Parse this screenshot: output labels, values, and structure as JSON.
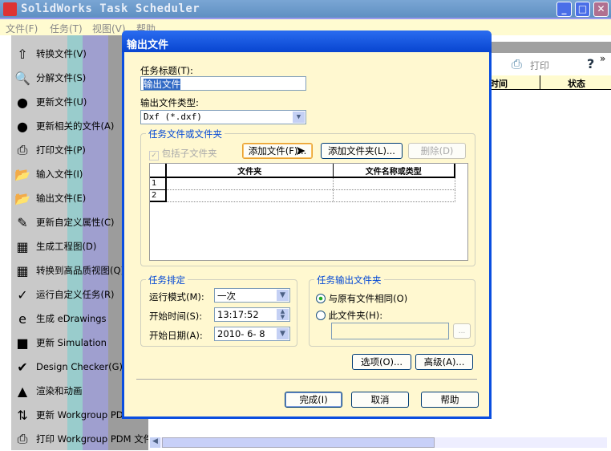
{
  "app": {
    "title": "SolidWorks Task Scheduler",
    "controls": {
      "minimize": "_",
      "maximize": "□",
      "close": "✕"
    }
  },
  "menu": [
    "文件(F)",
    "任务(T)",
    "视图(V)",
    "帮助"
  ],
  "sidebar": {
    "items": [
      {
        "label": "转换文件(V)",
        "icon": "sw-convert-icon",
        "glyph": "⇧"
      },
      {
        "label": "分解文件(S)",
        "icon": "magnifier-icon",
        "glyph": "🔍"
      },
      {
        "label": "更新文件(U)",
        "icon": "traffic-light-icon",
        "glyph": "●"
      },
      {
        "label": "更新相关的文件(A)",
        "icon": "traffic-light-link-icon",
        "glyph": "●"
      },
      {
        "label": "打印文件(P)",
        "icon": "printer-icon",
        "glyph": "⎙"
      },
      {
        "label": "输入文件(I)",
        "icon": "import-folder-icon",
        "glyph": "📂"
      },
      {
        "label": "输出文件(E)",
        "icon": "export-folder-icon",
        "glyph": "📂"
      },
      {
        "label": "更新自定义属性(C)",
        "icon": "properties-icon",
        "glyph": "✎"
      },
      {
        "label": "生成工程图(D)",
        "icon": "drawing-icon",
        "glyph": "▦"
      },
      {
        "label": "转换到高品质视图(Q)",
        "icon": "hq-view-icon",
        "glyph": "▦"
      },
      {
        "label": "运行自定义任务(R)",
        "icon": "custom-task-icon",
        "glyph": "✓"
      },
      {
        "label": "生成 eDrawings",
        "icon": "edrawings-icon",
        "glyph": "e"
      },
      {
        "label": "更新 Simulation",
        "icon": "simulation-icon",
        "glyph": "■"
      },
      {
        "label": "Design Checker(G)",
        "icon": "design-checker-icon",
        "glyph": "✔"
      },
      {
        "label": "渲染和动画",
        "icon": "render-icon",
        "glyph": "▲"
      },
      {
        "label": "更新 Workgroup PDM",
        "icon": "pdm-update-icon",
        "glyph": "⇅"
      },
      {
        "label": "打印 Workgroup PDM 文件",
        "icon": "pdm-print-icon",
        "glyph": "⎙"
      }
    ]
  },
  "toolbar": {
    "print": "打印",
    "help": "?",
    "more": "»"
  },
  "list_headers": [
    "时间",
    "状态"
  ],
  "dialog": {
    "title": "输出文件",
    "task_title_label": "任务标题(T):",
    "task_title_value": "输出文件",
    "type_label": "输出文件类型:",
    "type_value": "Dxf (*.dxf)",
    "files_group": "任务文件或文件夹",
    "include_subfolders": "包括子文件夹",
    "add_file": "添加文件(F)...",
    "add_folder": "添加文件夹(L)...",
    "delete": "删除(D)",
    "table_headers": [
      "文件夹",
      "文件名称或类型"
    ],
    "rows": [
      "1",
      "2"
    ],
    "schedule_group": "任务排定",
    "run_mode_label": "运行模式(M):",
    "run_mode_value": "一次",
    "start_time_label": "开始时间(S):",
    "start_time_value": "13:17:52",
    "start_date_label": "开始日期(A):",
    "start_date_value": "2010- 6- 8",
    "output_group": "任务输出文件夹",
    "same_as_original": "与原有文件相同(O)",
    "this_folder": "此文件夹(H):",
    "browse": "...",
    "options": "选项(O)...",
    "advanced": "高级(A)...",
    "finish": "完成(I)",
    "cancel": "取消",
    "help": "帮助"
  }
}
